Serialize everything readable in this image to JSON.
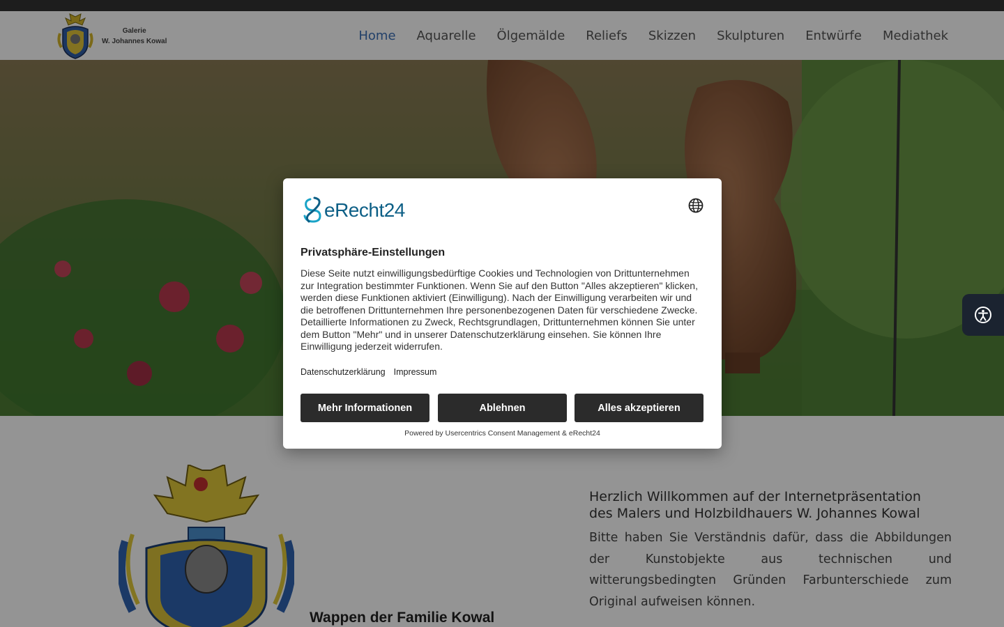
{
  "header": {
    "logo_line1": "Galerie",
    "logo_line2": "W. Johannes Kowal",
    "nav": [
      "Home",
      "Aquarelle",
      "Ölgemälde",
      "Reliefs",
      "Skizzen",
      "Skulpturen",
      "Entwürfe",
      "Mediathek"
    ],
    "active_nav": "Home",
    "accent_color": "#3b6fb6"
  },
  "content": {
    "crest_caption": "Wappen der Familie Kowal",
    "welcome_line1": "Herzlich Willkommen auf der Internetpräsentation",
    "welcome_line2": "des Malers und Holzbildhauers W. Johannes Kowal",
    "notice": "Bitte haben Sie Verständnis dafür, dass die Abbildungen der Kunstobjekte aus technischen und witterungsbedingten Gründen Farbunterschiede zum Original aufweisen können."
  },
  "consent": {
    "brand": "eRecht24",
    "language_icon": "globe-icon",
    "title": "Privatsphäre-Einstellungen",
    "body": "Diese Seite nutzt einwilligungsbedürftige Cookies und Technologien von Drittunternehmen zur Integration bestimmter Funktionen. Wenn Sie auf den Button \"Alles akzeptieren\" klicken, werden diese Funktionen aktiviert (Einwilligung). Nach der Einwilligung verarbeiten wir und die betroffenen Drittunternehmen Ihre personenbezogenen Daten für verschiedene Zwecke. Detaillierte Informationen zu Zweck, Rechtsgrundlagen, Drittunternehmen können Sie unter dem Button \"Mehr\" und in unserer Datenschutzerklärung einsehen. Sie können Ihre Einwilligung jederzeit widerrufen.",
    "link_privacy": "Datenschutzerklärung",
    "link_imprint": "Impressum",
    "btn_more": "Mehr Informationen",
    "btn_decline": "Ablehnen",
    "btn_accept": "Alles akzeptieren",
    "powered_by": "Powered by Usercentrics Consent Management & eRecht24",
    "brand_color": "#0d5f86",
    "button_color": "#2b2b2b"
  },
  "accessibility": {
    "icon": "accessibility-icon"
  }
}
